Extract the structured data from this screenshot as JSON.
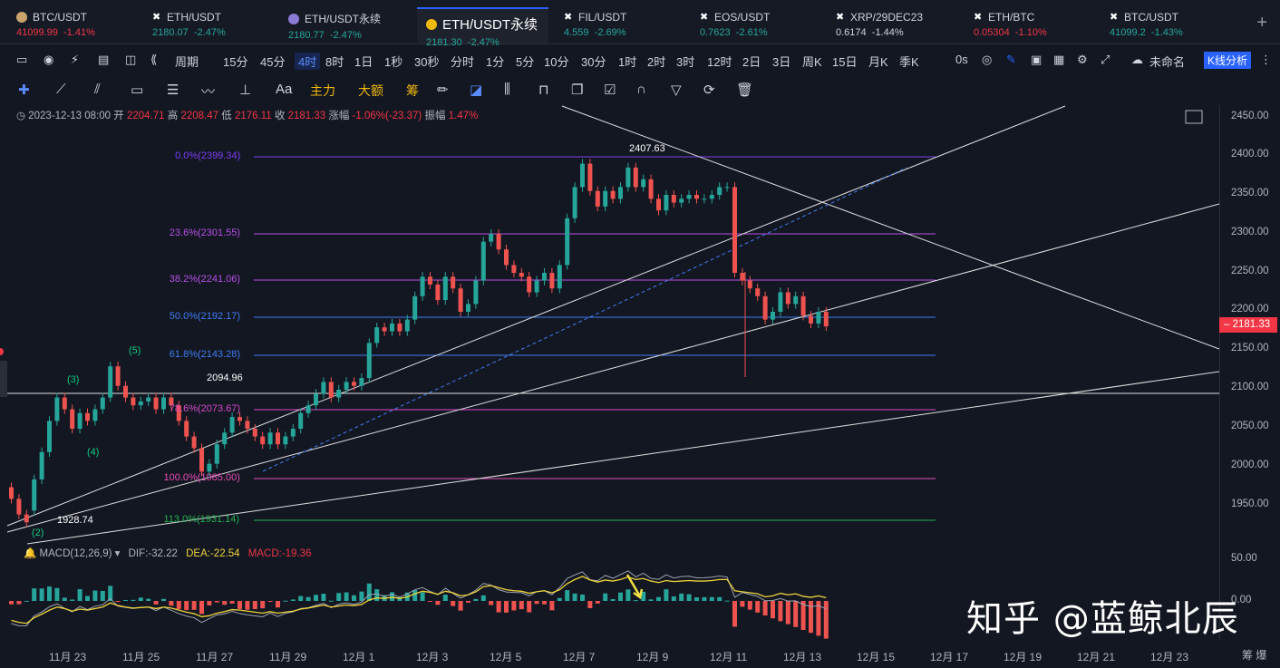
{
  "tabs": [
    {
      "name": "BTC/USDT",
      "price": "41099.99",
      "change": "-1.41%",
      "state": "down",
      "icon": "btc-coin"
    },
    {
      "name": "ETH/USDT",
      "price": "2180.07",
      "change": "-2.47%",
      "state": "up",
      "icon": "x-icon"
    },
    {
      "name": "ETH/USDT永续",
      "price": "2180.77",
      "change": "-2.47%",
      "state": "up",
      "icon": "eth-coin"
    },
    {
      "name": "ETH/USDT永续",
      "price": "2181.30",
      "change": "-2.47%",
      "state": "up",
      "icon": "bnb-coin"
    },
    {
      "name": "FIL/USDT",
      "price": "4.559",
      "change": "-2.69%",
      "state": "up",
      "icon": "x-icon"
    },
    {
      "name": "EOS/USDT",
      "price": "0.7623",
      "change": "-2.61%",
      "state": "up",
      "icon": "x-icon"
    },
    {
      "name": "XRP/29DEC23",
      "price": "0.6174",
      "change": "-1.44%",
      "state": "neutral",
      "icon": "x-icon"
    },
    {
      "name": "ETH/BTC",
      "price": "0.05304",
      "change": "-1.10%",
      "state": "down",
      "icon": "x-icon"
    },
    {
      "name": "BTC/USDT",
      "price": "41099.2",
      "change": "-1.43%",
      "state": "up",
      "icon": "x-icon"
    }
  ],
  "intervals": [
    "周期",
    "15分",
    "45分",
    "4时",
    "8时",
    "1日",
    "1秒",
    "30秒",
    "分时",
    "1分",
    "5分",
    "10分",
    "30分",
    "1时",
    "2时",
    "3时",
    "12时",
    "2日",
    "3日",
    "周K",
    "15日",
    "月K",
    "季K"
  ],
  "active_interval": "4时",
  "toolbar_right": {
    "zero": "0s",
    "name": "未命名",
    "analysis": "K线分析"
  },
  "draw_tools": {
    "zhuli": "主力",
    "dae": "大额",
    "chou": "筹",
    "aa": "Aa"
  },
  "info": {
    "date": "2023-12-13 08:00",
    "open_l": "开",
    "open": "2204.71",
    "high_l": "高",
    "high": "2208.47",
    "low_l": "低",
    "low": "2176.11",
    "close_l": "收",
    "close": "2181.33",
    "chg_l": "涨幅",
    "chg": "-1.06%(-23.37)",
    "amp_l": "振幅",
    "amp": "1.47%"
  },
  "macd": {
    "label": "MACD(12,26,9)",
    "dif": "DIF:-32.22",
    "dea": "DEA:-22.54",
    "macd": "MACD:-19.36"
  },
  "current_price": "2181.33",
  "y_labels": [
    "2450.00",
    "2400.00",
    "2350.00",
    "2300.00",
    "2250.00",
    "2200.00",
    "2150.00",
    "2100.00",
    "2050.00",
    "2000.00",
    "1950.00"
  ],
  "macd_y": [
    "50.00",
    "0.00"
  ],
  "x_labels": [
    "11月 23",
    "11月 25",
    "11月 27",
    "11月 29",
    "12月 1",
    "12月 3",
    "12月 5",
    "12月 7",
    "12月 9",
    "12月 11",
    "12月 13",
    "12月 15",
    "12月 17",
    "12月 19",
    "12月 21",
    "12月 23"
  ],
  "fib": [
    {
      "label": "0.0%(2399.34)",
      "color": "#7b3ff2"
    },
    {
      "label": "23.6%(2301.55)",
      "color": "#b84fe8"
    },
    {
      "label": "38.2%(2241.06)",
      "color": "#b84fe8"
    },
    {
      "label": "50.0%(2192.17)",
      "color": "#3f7cf2"
    },
    {
      "label": "61.8%(2143.28)",
      "color": "#3f7cf2"
    },
    {
      "label": "78.6%(2073.67)",
      "color": "#d64bc9"
    },
    {
      "label": "100.0%(1985.00)",
      "color": "#e84cb5"
    },
    {
      "label": "113.0%(1931.14)",
      "color": "#22b14c"
    }
  ],
  "annotations": {
    "high": "2407.63",
    "low": "1928.74",
    "level": "2094.96"
  },
  "waves": [
    "(2)",
    "(3)",
    "(4)",
    "(5)"
  ],
  "watermark": "知乎 @蓝鲸北辰",
  "corner": "筹 爆",
  "chart_data": {
    "type": "candlestick",
    "interval": "4h",
    "ylim": [
      1900,
      2470
    ],
    "candles": [
      [
        1975,
        1960
      ],
      [
        1960,
        1940
      ],
      [
        1940,
        1930
      ],
      [
        1945,
        1985
      ],
      [
        1985,
        2020
      ],
      [
        2020,
        2060
      ],
      [
        2060,
        2090
      ],
      [
        2090,
        2075
      ],
      [
        2075,
        2050
      ],
      [
        2050,
        2070
      ],
      [
        2070,
        2060
      ],
      [
        2060,
        2075
      ],
      [
        2075,
        2090
      ],
      [
        2090,
        2130
      ],
      [
        2130,
        2105
      ],
      [
        2105,
        2090
      ],
      [
        2090,
        2080
      ],
      [
        2080,
        2085
      ],
      [
        2085,
        2090
      ],
      [
        2090,
        2075
      ],
      [
        2075,
        2090
      ],
      [
        2090,
        2080
      ],
      [
        2080,
        2060
      ],
      [
        2060,
        2040
      ],
      [
        2040,
        2025
      ],
      [
        2025,
        1995
      ],
      [
        1995,
        2005
      ],
      [
        2005,
        2030
      ],
      [
        2030,
        2045
      ],
      [
        2045,
        2065
      ],
      [
        2065,
        2060
      ],
      [
        2060,
        2050
      ],
      [
        2050,
        2040
      ],
      [
        2040,
        2030
      ],
      [
        2030,
        2045
      ],
      [
        2045,
        2030
      ],
      [
        2030,
        2040
      ],
      [
        2040,
        2050
      ],
      [
        2050,
        2070
      ],
      [
        2070,
        2080
      ],
      [
        2080,
        2095
      ],
      [
        2095,
        2110
      ],
      [
        2110,
        2090
      ],
      [
        2090,
        2100
      ],
      [
        2100,
        2110
      ],
      [
        2110,
        2105
      ],
      [
        2105,
        2115
      ],
      [
        2115,
        2160
      ],
      [
        2160,
        2180
      ],
      [
        2180,
        2175
      ],
      [
        2175,
        2185
      ],
      [
        2185,
        2175
      ],
      [
        2175,
        2190
      ],
      [
        2190,
        2220
      ],
      [
        2220,
        2245
      ],
      [
        2245,
        2235
      ],
      [
        2235,
        2215
      ],
      [
        2215,
        2245
      ],
      [
        2245,
        2230
      ],
      [
        2230,
        2200
      ],
      [
        2200,
        2210
      ],
      [
        2210,
        2240
      ],
      [
        2240,
        2290
      ],
      [
        2290,
        2300
      ],
      [
        2300,
        2280
      ],
      [
        2280,
        2260
      ],
      [
        2260,
        2250
      ],
      [
        2250,
        2245
      ],
      [
        2245,
        2225
      ],
      [
        2225,
        2240
      ],
      [
        2240,
        2250
      ],
      [
        2250,
        2230
      ],
      [
        2230,
        2260
      ],
      [
        2260,
        2320
      ],
      [
        2320,
        2360
      ],
      [
        2360,
        2390
      ],
      [
        2390,
        2355
      ],
      [
        2355,
        2335
      ],
      [
        2335,
        2355
      ],
      [
        2355,
        2345
      ],
      [
        2345,
        2360
      ],
      [
        2360,
        2385
      ],
      [
        2385,
        2360
      ],
      [
        2360,
        2370
      ],
      [
        2370,
        2345
      ],
      [
        2345,
        2330
      ],
      [
        2330,
        2350
      ],
      [
        2350,
        2340
      ],
      [
        2340,
        2345
      ],
      [
        2345,
        2350
      ],
      [
        2350,
        2345
      ],
      [
        2345,
        2345
      ],
      [
        2345,
        2350
      ],
      [
        2350,
        2360
      ],
      [
        2360,
        2360
      ],
      [
        2360,
        2250
      ],
      [
        2250,
        2240
      ],
      [
        2240,
        2230
      ],
      [
        2230,
        2220
      ],
      [
        2220,
        2190
      ],
      [
        2190,
        2200
      ],
      [
        2200,
        2225
      ],
      [
        2225,
        2210
      ],
      [
        2210,
        2220
      ],
      [
        2220,
        2195
      ],
      [
        2195,
        2185
      ],
      [
        2185,
        2200
      ],
      [
        2200,
        2181.33
      ]
    ]
  }
}
